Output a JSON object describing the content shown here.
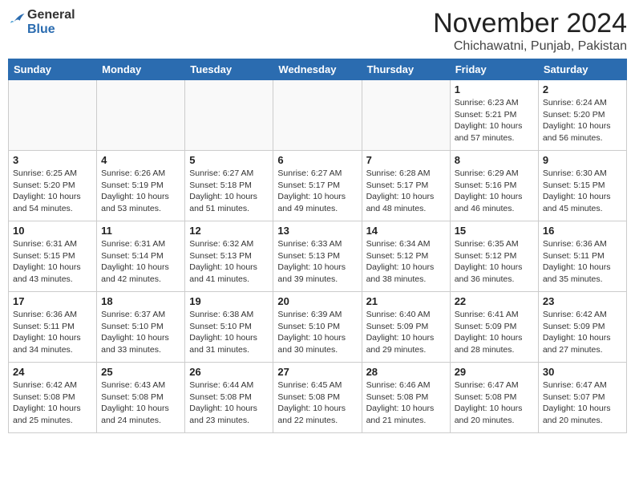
{
  "header": {
    "logo_line1": "General",
    "logo_line2": "Blue",
    "month": "November 2024",
    "location": "Chichawatni, Punjab, Pakistan"
  },
  "days_of_week": [
    "Sunday",
    "Monday",
    "Tuesday",
    "Wednesday",
    "Thursday",
    "Friday",
    "Saturday"
  ],
  "weeks": [
    [
      {
        "day": "",
        "info": ""
      },
      {
        "day": "",
        "info": ""
      },
      {
        "day": "",
        "info": ""
      },
      {
        "day": "",
        "info": ""
      },
      {
        "day": "",
        "info": ""
      },
      {
        "day": "1",
        "info": "Sunrise: 6:23 AM\nSunset: 5:21 PM\nDaylight: 10 hours\nand 57 minutes."
      },
      {
        "day": "2",
        "info": "Sunrise: 6:24 AM\nSunset: 5:20 PM\nDaylight: 10 hours\nand 56 minutes."
      }
    ],
    [
      {
        "day": "3",
        "info": "Sunrise: 6:25 AM\nSunset: 5:20 PM\nDaylight: 10 hours\nand 54 minutes."
      },
      {
        "day": "4",
        "info": "Sunrise: 6:26 AM\nSunset: 5:19 PM\nDaylight: 10 hours\nand 53 minutes."
      },
      {
        "day": "5",
        "info": "Sunrise: 6:27 AM\nSunset: 5:18 PM\nDaylight: 10 hours\nand 51 minutes."
      },
      {
        "day": "6",
        "info": "Sunrise: 6:27 AM\nSunset: 5:17 PM\nDaylight: 10 hours\nand 49 minutes."
      },
      {
        "day": "7",
        "info": "Sunrise: 6:28 AM\nSunset: 5:17 PM\nDaylight: 10 hours\nand 48 minutes."
      },
      {
        "day": "8",
        "info": "Sunrise: 6:29 AM\nSunset: 5:16 PM\nDaylight: 10 hours\nand 46 minutes."
      },
      {
        "day": "9",
        "info": "Sunrise: 6:30 AM\nSunset: 5:15 PM\nDaylight: 10 hours\nand 45 minutes."
      }
    ],
    [
      {
        "day": "10",
        "info": "Sunrise: 6:31 AM\nSunset: 5:15 PM\nDaylight: 10 hours\nand 43 minutes."
      },
      {
        "day": "11",
        "info": "Sunrise: 6:31 AM\nSunset: 5:14 PM\nDaylight: 10 hours\nand 42 minutes."
      },
      {
        "day": "12",
        "info": "Sunrise: 6:32 AM\nSunset: 5:13 PM\nDaylight: 10 hours\nand 41 minutes."
      },
      {
        "day": "13",
        "info": "Sunrise: 6:33 AM\nSunset: 5:13 PM\nDaylight: 10 hours\nand 39 minutes."
      },
      {
        "day": "14",
        "info": "Sunrise: 6:34 AM\nSunset: 5:12 PM\nDaylight: 10 hours\nand 38 minutes."
      },
      {
        "day": "15",
        "info": "Sunrise: 6:35 AM\nSunset: 5:12 PM\nDaylight: 10 hours\nand 36 minutes."
      },
      {
        "day": "16",
        "info": "Sunrise: 6:36 AM\nSunset: 5:11 PM\nDaylight: 10 hours\nand 35 minutes."
      }
    ],
    [
      {
        "day": "17",
        "info": "Sunrise: 6:36 AM\nSunset: 5:11 PM\nDaylight: 10 hours\nand 34 minutes."
      },
      {
        "day": "18",
        "info": "Sunrise: 6:37 AM\nSunset: 5:10 PM\nDaylight: 10 hours\nand 33 minutes."
      },
      {
        "day": "19",
        "info": "Sunrise: 6:38 AM\nSunset: 5:10 PM\nDaylight: 10 hours\nand 31 minutes."
      },
      {
        "day": "20",
        "info": "Sunrise: 6:39 AM\nSunset: 5:10 PM\nDaylight: 10 hours\nand 30 minutes."
      },
      {
        "day": "21",
        "info": "Sunrise: 6:40 AM\nSunset: 5:09 PM\nDaylight: 10 hours\nand 29 minutes."
      },
      {
        "day": "22",
        "info": "Sunrise: 6:41 AM\nSunset: 5:09 PM\nDaylight: 10 hours\nand 28 minutes."
      },
      {
        "day": "23",
        "info": "Sunrise: 6:42 AM\nSunset: 5:09 PM\nDaylight: 10 hours\nand 27 minutes."
      }
    ],
    [
      {
        "day": "24",
        "info": "Sunrise: 6:42 AM\nSunset: 5:08 PM\nDaylight: 10 hours\nand 25 minutes."
      },
      {
        "day": "25",
        "info": "Sunrise: 6:43 AM\nSunset: 5:08 PM\nDaylight: 10 hours\nand 24 minutes."
      },
      {
        "day": "26",
        "info": "Sunrise: 6:44 AM\nSunset: 5:08 PM\nDaylight: 10 hours\nand 23 minutes."
      },
      {
        "day": "27",
        "info": "Sunrise: 6:45 AM\nSunset: 5:08 PM\nDaylight: 10 hours\nand 22 minutes."
      },
      {
        "day": "28",
        "info": "Sunrise: 6:46 AM\nSunset: 5:08 PM\nDaylight: 10 hours\nand 21 minutes."
      },
      {
        "day": "29",
        "info": "Sunrise: 6:47 AM\nSunset: 5:08 PM\nDaylight: 10 hours\nand 20 minutes."
      },
      {
        "day": "30",
        "info": "Sunrise: 6:47 AM\nSunset: 5:07 PM\nDaylight: 10 hours\nand 20 minutes."
      }
    ]
  ]
}
